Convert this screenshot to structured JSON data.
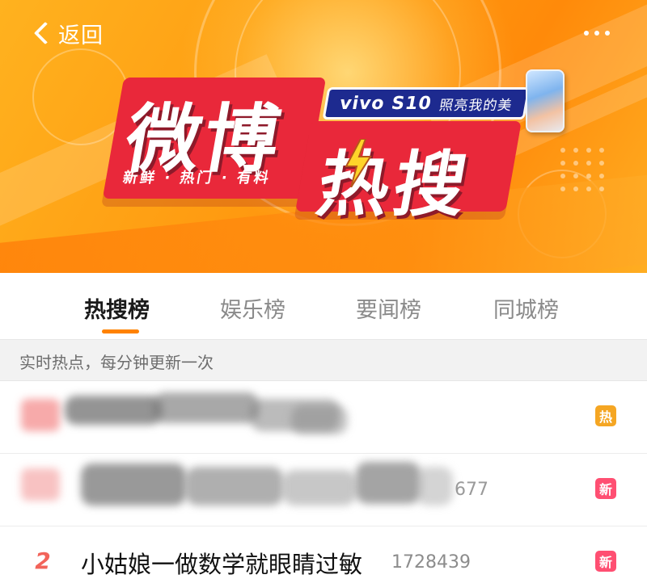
{
  "header": {
    "back_label": "返回",
    "more_icon": "more-dots-icon"
  },
  "banner": {
    "logo_line1": "微博",
    "logo_line2": "热搜",
    "slogan": "新鲜 · 热门 · 有料",
    "sponsor_brand": "vivo S10",
    "sponsor_tagline": "照亮我的美",
    "colors": {
      "orange": "#ff9a10",
      "red": "#e9283a",
      "navy": "#1d2a8f"
    }
  },
  "tabs": [
    {
      "label": "热搜榜",
      "active": true
    },
    {
      "label": "娱乐榜",
      "active": false
    },
    {
      "label": "要闻榜",
      "active": false
    },
    {
      "label": "同城榜",
      "active": false
    }
  ],
  "notice": "实时热点，每分钟更新一次",
  "list": [
    {
      "rank": "",
      "title": "",
      "count": "",
      "badge": "热",
      "badge_type": "hot",
      "obscured": true
    },
    {
      "rank": "",
      "title": "",
      "count": "677",
      "badge": "新",
      "badge_type": "new",
      "obscured": true
    },
    {
      "rank": "2",
      "title": "小姑娘一做数学就眼睛过敏",
      "count": "1728439",
      "badge": "新",
      "badge_type": "new",
      "obscured": false
    }
  ],
  "accent": "#ff8200"
}
